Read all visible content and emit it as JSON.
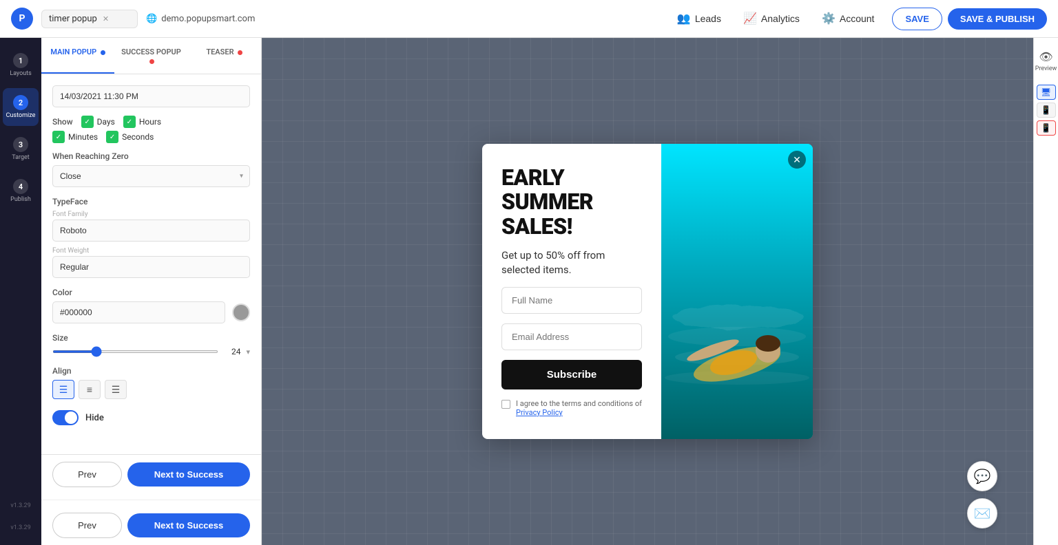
{
  "topbar": {
    "logo_text": "P",
    "project_name": "timer popup",
    "close_label": "×",
    "url": "demo.popupsmart.com",
    "leads_label": "Leads",
    "analytics_label": "Analytics",
    "account_label": "Account",
    "save_label": "SAVE",
    "save_publish_label": "SAVE & PUBLISH"
  },
  "sidebar": {
    "steps": [
      {
        "num": "1",
        "label": "Layouts"
      },
      {
        "num": "2",
        "label": "Customize"
      },
      {
        "num": "3",
        "label": "Target"
      },
      {
        "num": "4",
        "label": "Publish"
      }
    ],
    "version": "v1.3.29",
    "version2": "v1.3.29"
  },
  "panel": {
    "tabs": [
      {
        "label": "MAIN POPUP",
        "dot": "blue",
        "active": true
      },
      {
        "label": "SUCCESS POPUP",
        "dot": "red"
      },
      {
        "label": "TEASER",
        "dot": "red"
      }
    ],
    "date_value": "14/03/2021 11:30 PM",
    "show_label": "Show",
    "show_items": [
      "Days",
      "Hours",
      "Minutes",
      "Seconds"
    ],
    "when_reaching_zero_label": "When Reaching Zero",
    "when_option": "Close",
    "typeface_label": "TypeFace",
    "font_family_hint": "Font Family",
    "font_family_value": "Roboto",
    "font_weight_hint": "Font Weight",
    "color_label": "Color",
    "color_value": "#000000",
    "size_label": "Size",
    "size_value": "24",
    "align_label": "Align",
    "align_options": [
      "left",
      "center",
      "right"
    ],
    "hide_label": "Hide",
    "hide_toggle": true,
    "footer_rows": [
      {
        "prev": "Prev",
        "next": "Next to Success"
      },
      {
        "prev": "Prev",
        "next": "Next to Success"
      }
    ]
  },
  "popup": {
    "title": "EARLY SUMMER SALES!",
    "subtitle": "Get up to 50% off from selected items.",
    "fullname_placeholder": "Full Name",
    "email_placeholder": "Email Address",
    "subscribe_label": "Subscribe",
    "privacy_text": "I agree to the terms and conditions of",
    "privacy_link": "Privacy Policy"
  },
  "right_panel": {
    "preview_label": "Preview"
  }
}
